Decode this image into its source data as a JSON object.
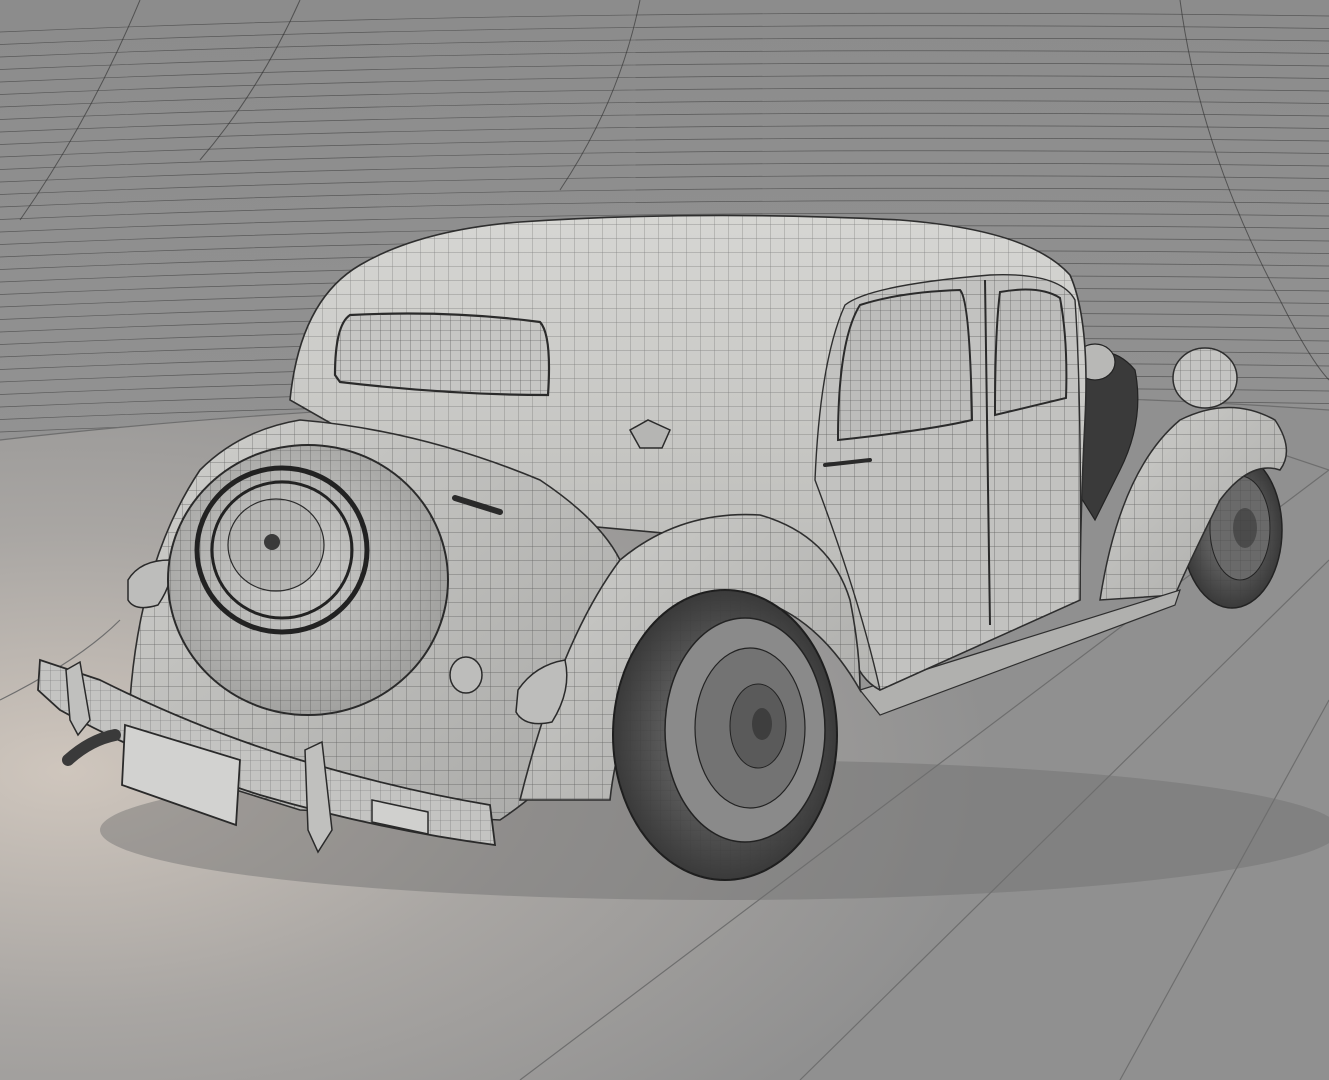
{
  "scene": {
    "subject": "vintage-sedan-wireframe-render",
    "colors": {
      "backdrop": "#8a8a8a",
      "floor": "#9c9c9c",
      "floor_highlight": "#c9c2bb",
      "car_body": "#c9c9c7",
      "car_shadow": "#8e8e8c",
      "wire": "#2c2c2c",
      "tire": "#4a4a4a"
    }
  }
}
